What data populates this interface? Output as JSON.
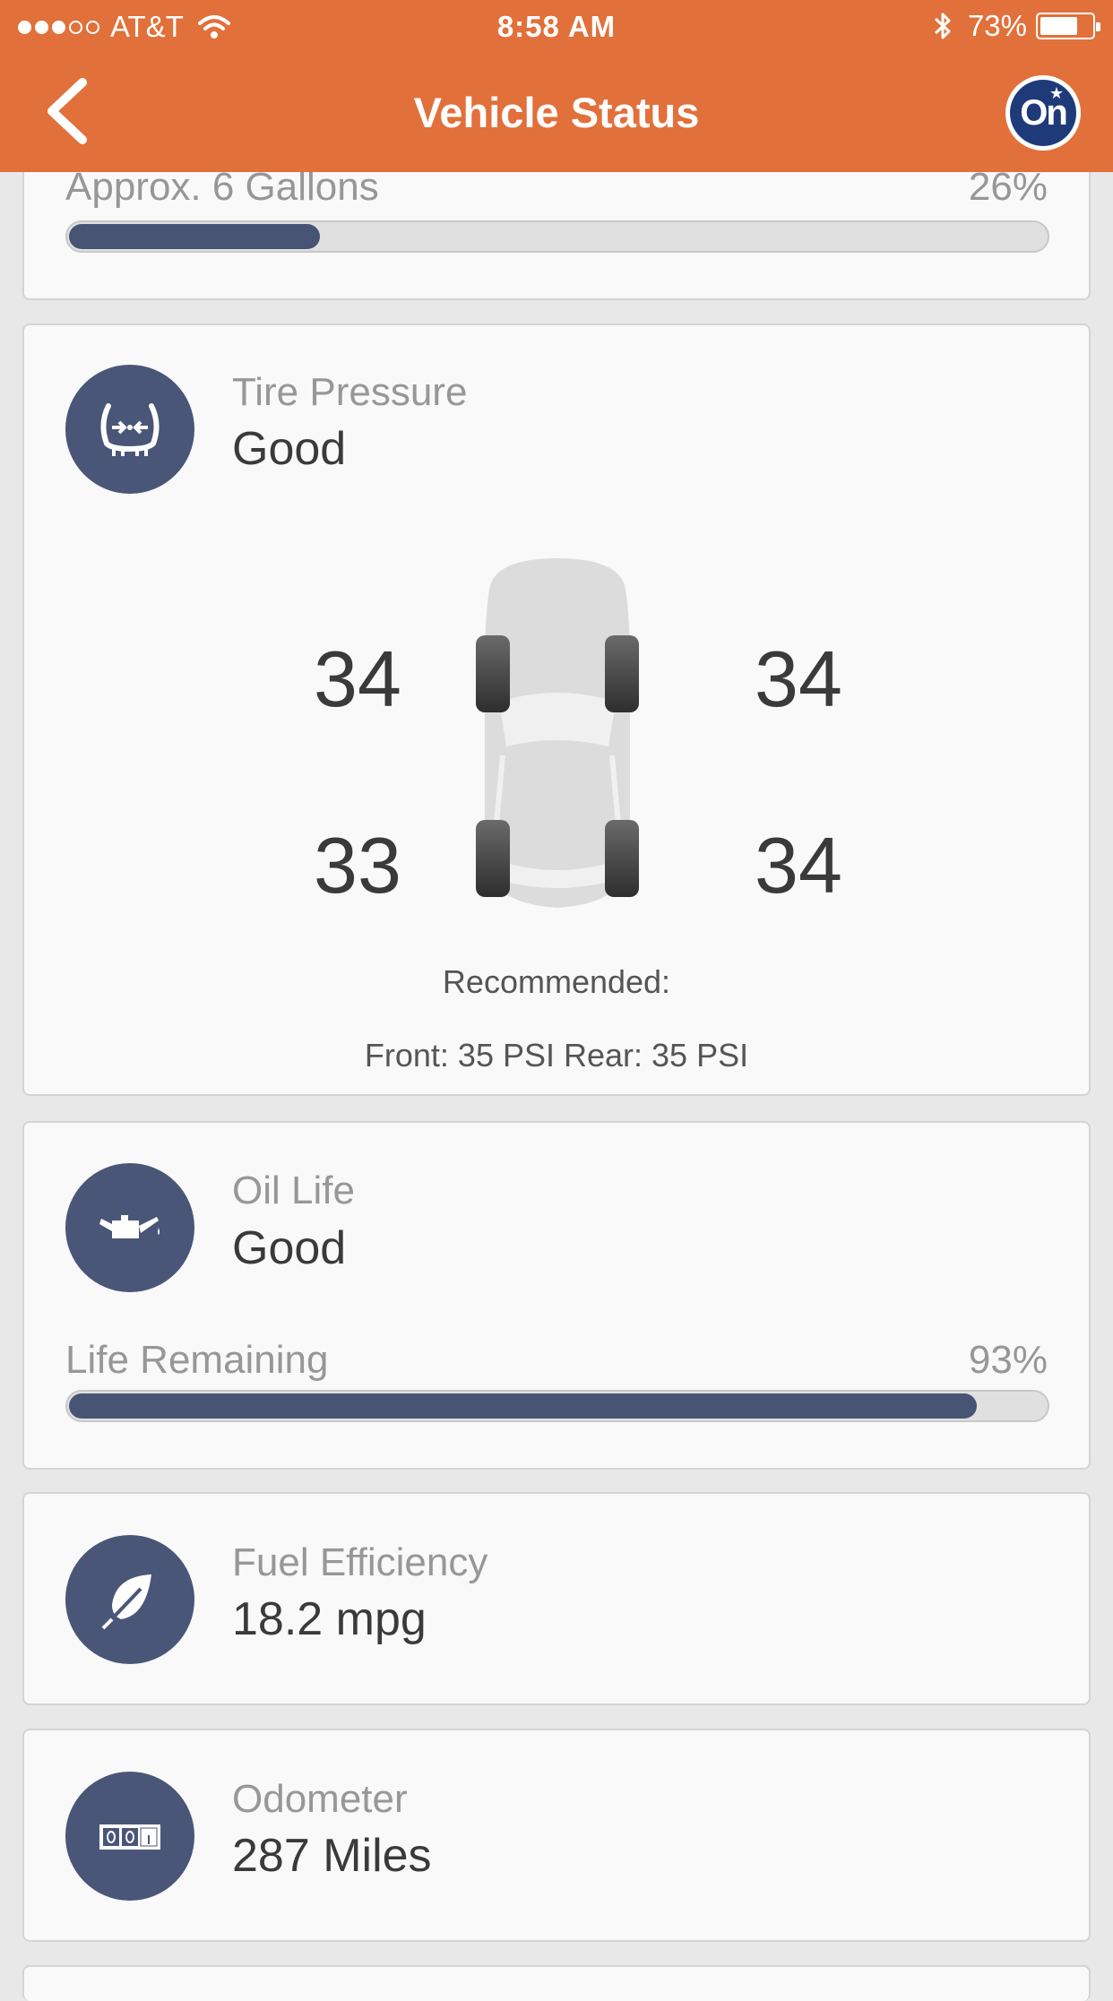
{
  "status_bar": {
    "carrier": "AT&T",
    "time": "8:58 AM",
    "battery_percent": "73%",
    "battery_level": 0.73,
    "signal_bars_filled": 3,
    "signal_bars_total": 5
  },
  "nav": {
    "title": "Vehicle Status",
    "brand_badge": "On"
  },
  "fuel": {
    "label": "Approx. 6 Gallons",
    "percent_text": "26%",
    "level": 0.26
  },
  "tire_pressure": {
    "title": "Tire Pressure",
    "status": "Good",
    "front_left": "34",
    "front_right": "34",
    "rear_left": "33",
    "rear_right": "34",
    "recommended_label": "Recommended:",
    "recommended_values": "Front: 35 PSI Rear: 35 PSI"
  },
  "oil_life": {
    "title": "Oil Life",
    "status": "Good",
    "remaining_label": "Life Remaining",
    "percent_text": "93%",
    "level": 0.93
  },
  "fuel_efficiency": {
    "title": "Fuel Efficiency",
    "value": "18.2 mpg"
  },
  "odometer": {
    "title": "Odometer",
    "value": "287 Miles"
  },
  "colors": {
    "header": "#e2703a",
    "accent": "#4a5678",
    "bar_fill": "#475474",
    "badge": "#1e3a79"
  },
  "icons": [
    "back-chevron-icon",
    "onstar-logo-icon",
    "wifi-icon",
    "bluetooth-icon",
    "battery-icon",
    "tire-pressure-icon",
    "oil-can-icon",
    "leaf-icon",
    "odometer-icon"
  ]
}
